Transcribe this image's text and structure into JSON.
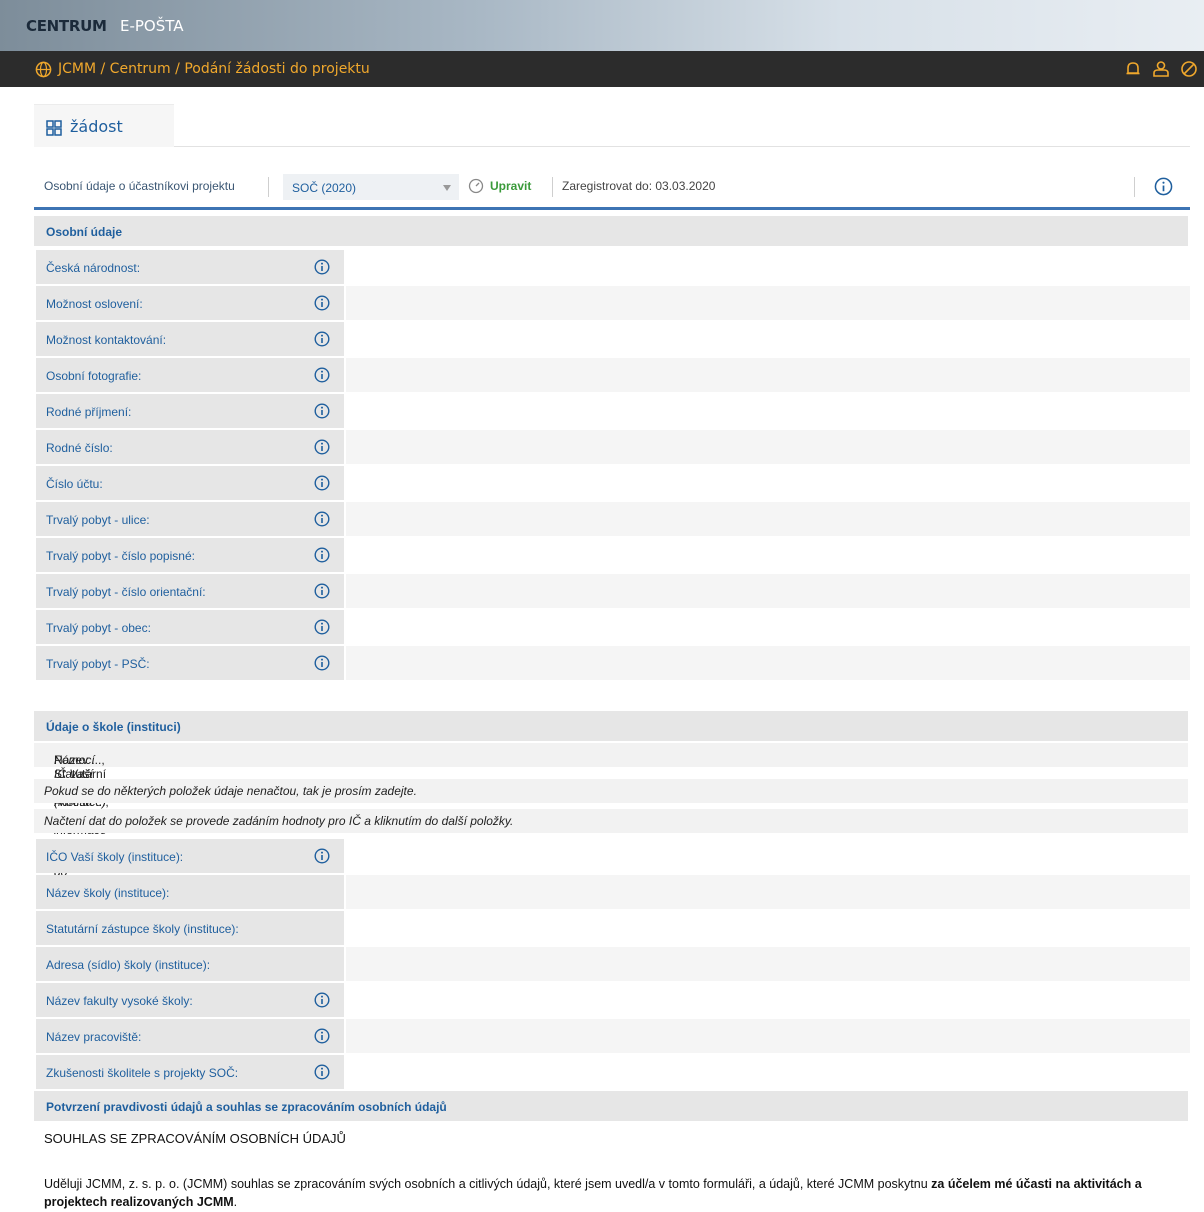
{
  "header": {
    "nav_items": [
      "CENTRUM",
      "E-POŠTA"
    ],
    "breadcrumb": "JCMM / Centrum / Podání žádosti do projektu",
    "accent_color": "#f0a82c"
  },
  "tab": {
    "label": "žádost"
  },
  "toolbar": {
    "label": "Osobní údaje o účastníkovi projektu",
    "select_value": "SOČ (2020)",
    "edit_label": "Upravit",
    "register_until": "Zaregistrovat do: 03.03.2020"
  },
  "sections": {
    "personal": "Osobní údaje",
    "school": "Údaje o škole (instituci)",
    "consent": "Potvrzení pravdivosti údajů a souhlas se zpracováním osobních údajů"
  },
  "personal_rows": [
    "Česká národnost:",
    "Možnost oslovení:",
    "Možnost kontaktování:",
    "Osobní fotografie:",
    "Rodné příjmení:",
    "Rodné číslo:",
    "Číslo účtu:",
    "Trvalý pobyt - ulice:",
    "Trvalý pobyt - číslo popisné:",
    "Trvalý pobyt - číslo orientační:",
    "Trvalý pobyt - obec:",
    "Trvalý pobyt - PSČ:"
  ],
  "school_notes": {
    "line1_italic": "Pomocí IČ Vaší školy (instituce) se načtou informace z databáze do položek:",
    "line1_plain": " Název ..., Statutární zástupce..., Adresa ...,",
    "line2": "Pokud se do některých položek údaje nenačtou, tak je prosím zadejte.",
    "line3": "Načtení dat do položek se provede zadáním hodnoty pro IČ a kliknutím do další položky."
  },
  "school_rows": [
    "IČO Vaší školy (instituce):",
    "Název školy (instituce):",
    "Statutární zástupce školy (instituce):",
    "Adresa (sídlo) školy (instituce):",
    "Název fakulty vysoké školy:",
    "Název pracoviště:",
    "Zkušenosti školitele s projekty SOČ:"
  ],
  "consent": {
    "title": "SOUHLAS SE ZPRACOVÁNÍM OSOBNÍCH ÚDAJŮ",
    "text_plain": "Uděluji JCMM, z. s. p. o. (JCMM) souhlas se zpracováním svých osobních a citlivých údajů, které jsem uvedl/a v tomto formuláři, a údajů, které JCMM poskytnu ",
    "text_bold": "za účelem mé účasti na aktivitách a projektech realizovaných JCMM",
    "text_end": "."
  }
}
